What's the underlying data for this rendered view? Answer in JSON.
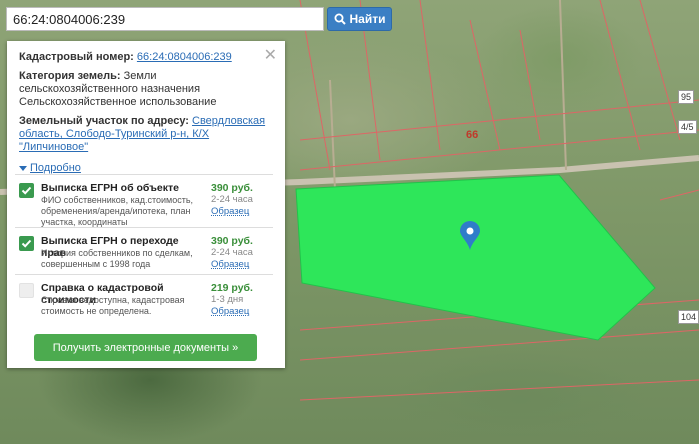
{
  "search": {
    "value": "66:24:0804006:239",
    "button_label": "Найти"
  },
  "map": {
    "parcel_number_label": "66",
    "side_labels": [
      "95",
      "4/5",
      "104"
    ],
    "marker_icon": "location-pin-icon",
    "parcel_color": "#2ee65a"
  },
  "info": {
    "cadastral_label": "Кадастровый номер:",
    "cadastral_value": "66:24:0804006:239",
    "category_label": "Категория земель:",
    "category_value": "Земли сельскохозяйственного назначения",
    "usage_value": "Сельскохозяйственное использование",
    "address_label": "Земельный участок по адресу:",
    "address_value": "Свердловская область, Слободо-Туринский р-н, К/Х \"Липчиновое\"",
    "more_label": "Подробно"
  },
  "documents": [
    {
      "title": "Выписка ЕГРН об объекте",
      "desc": "ФИО собственников, кад.стоимость, обременения/аренда/ипотека, план участка, координаты",
      "price": "390 руб.",
      "duration": "2-24 часа",
      "sample": "Образец",
      "checked": true
    },
    {
      "title": "Выписка ЕГРН о переходе прав",
      "desc": "История собственников по сделкам, совершенным с 1998 года",
      "price": "390 руб.",
      "duration": "2-24 часа",
      "sample": "Образец",
      "checked": true
    },
    {
      "title": "Справка о кадастровой стоимости",
      "desc": "Справка недоступна, кадастровая стоимость не определена.",
      "price": "219 руб.",
      "duration": "1-3 дня",
      "sample": "Образец",
      "checked": false
    }
  ],
  "get_button_label": "Получить электронные документы »",
  "colors": {
    "accent_blue": "#3b7fc4",
    "green_button": "#4cab4f",
    "checkbox_green": "#3a9a4f",
    "price_green": "#3a8f3a"
  }
}
